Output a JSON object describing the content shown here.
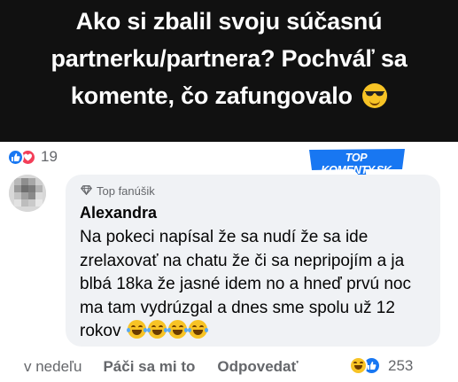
{
  "banner": {
    "title_line1": "Ako si zbalil svoju súčasnú",
    "title_line2": "partnerku/partnera? Pochváľ sa",
    "title_line3": "komente, čo zafungovalo",
    "emoji": "sunglasses-emoji"
  },
  "post_reactions": {
    "icons": [
      "like-icon",
      "love-icon"
    ],
    "count": "19"
  },
  "badge": {
    "text": "TOP KOMENTY.SK",
    "color": "#1877f2"
  },
  "comment": {
    "fan_label": "Top fanúšik",
    "author": "Alexandra",
    "text": "Na pokeci napísal že sa nudí že sa ide zrelaxovať na chatu že či sa nepripojím a ja blbá 18ka že jasné idem no a hneď prvú noc ma tam vydrúzgal a dnes sme spolu už 12 rokov",
    "emojis": [
      "laughing-tears-emoji",
      "laughing-tears-emoji",
      "laughing-tears-emoji",
      "laughing-tears-emoji"
    ],
    "bubble_color": "#f0f2f5"
  },
  "actions": {
    "time": "v nedeľu",
    "like_label": "Páči sa mi to",
    "reply_label": "Odpovedať",
    "reaction_icons": [
      "haha-icon",
      "like-icon"
    ],
    "reaction_count": "253"
  },
  "colors": {
    "banner_bg": "#111111",
    "facebook_blue": "#1877f2",
    "love_red": "#f33e58",
    "secondary_text": "#65676b"
  }
}
